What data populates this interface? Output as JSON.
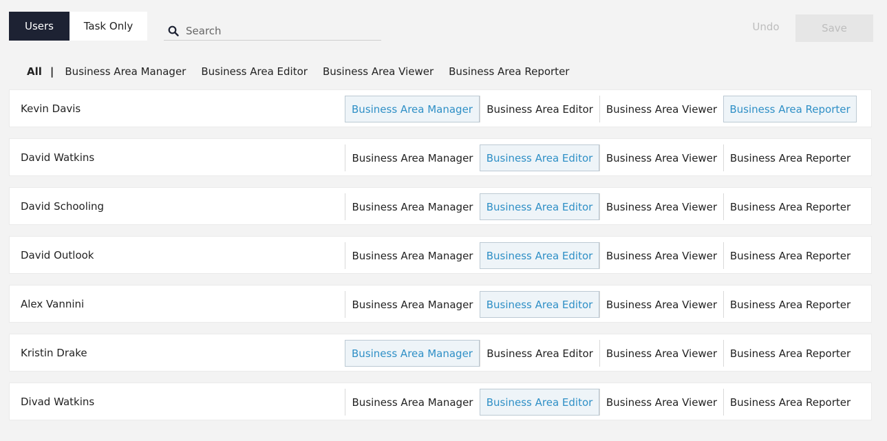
{
  "tabs": [
    {
      "label": "Users",
      "active": true
    },
    {
      "label": "Task Only",
      "active": false
    }
  ],
  "search": {
    "placeholder": "Search",
    "value": ""
  },
  "actions": {
    "undo_label": "Undo",
    "save_label": "Save"
  },
  "filters": {
    "all_label": "All",
    "separator": "|",
    "items": [
      "Business Area Manager",
      "Business Area Editor",
      "Business Area Viewer",
      "Business Area Reporter"
    ]
  },
  "roles": [
    "Business Area Manager",
    "Business Area Editor",
    "Business Area Viewer",
    "Business Area Reporter"
  ],
  "users": [
    {
      "name": "Kevin Davis",
      "selected": [
        0,
        3
      ]
    },
    {
      "name": "David Watkins",
      "selected": [
        1
      ]
    },
    {
      "name": "David Schooling",
      "selected": [
        1
      ]
    },
    {
      "name": "David Outlook",
      "selected": [
        1
      ]
    },
    {
      "name": "Alex Vannini",
      "selected": [
        1
      ]
    },
    {
      "name": "Kristin Drake",
      "selected": [
        0
      ]
    },
    {
      "name": "Divad Watkins",
      "selected": [
        1
      ]
    }
  ],
  "colors": {
    "active_tab_bg": "#1d2233",
    "selected_role_text": "#2e8fc6",
    "selected_role_bg": "#eef4f8",
    "disabled_text": "#bdbdbd"
  }
}
